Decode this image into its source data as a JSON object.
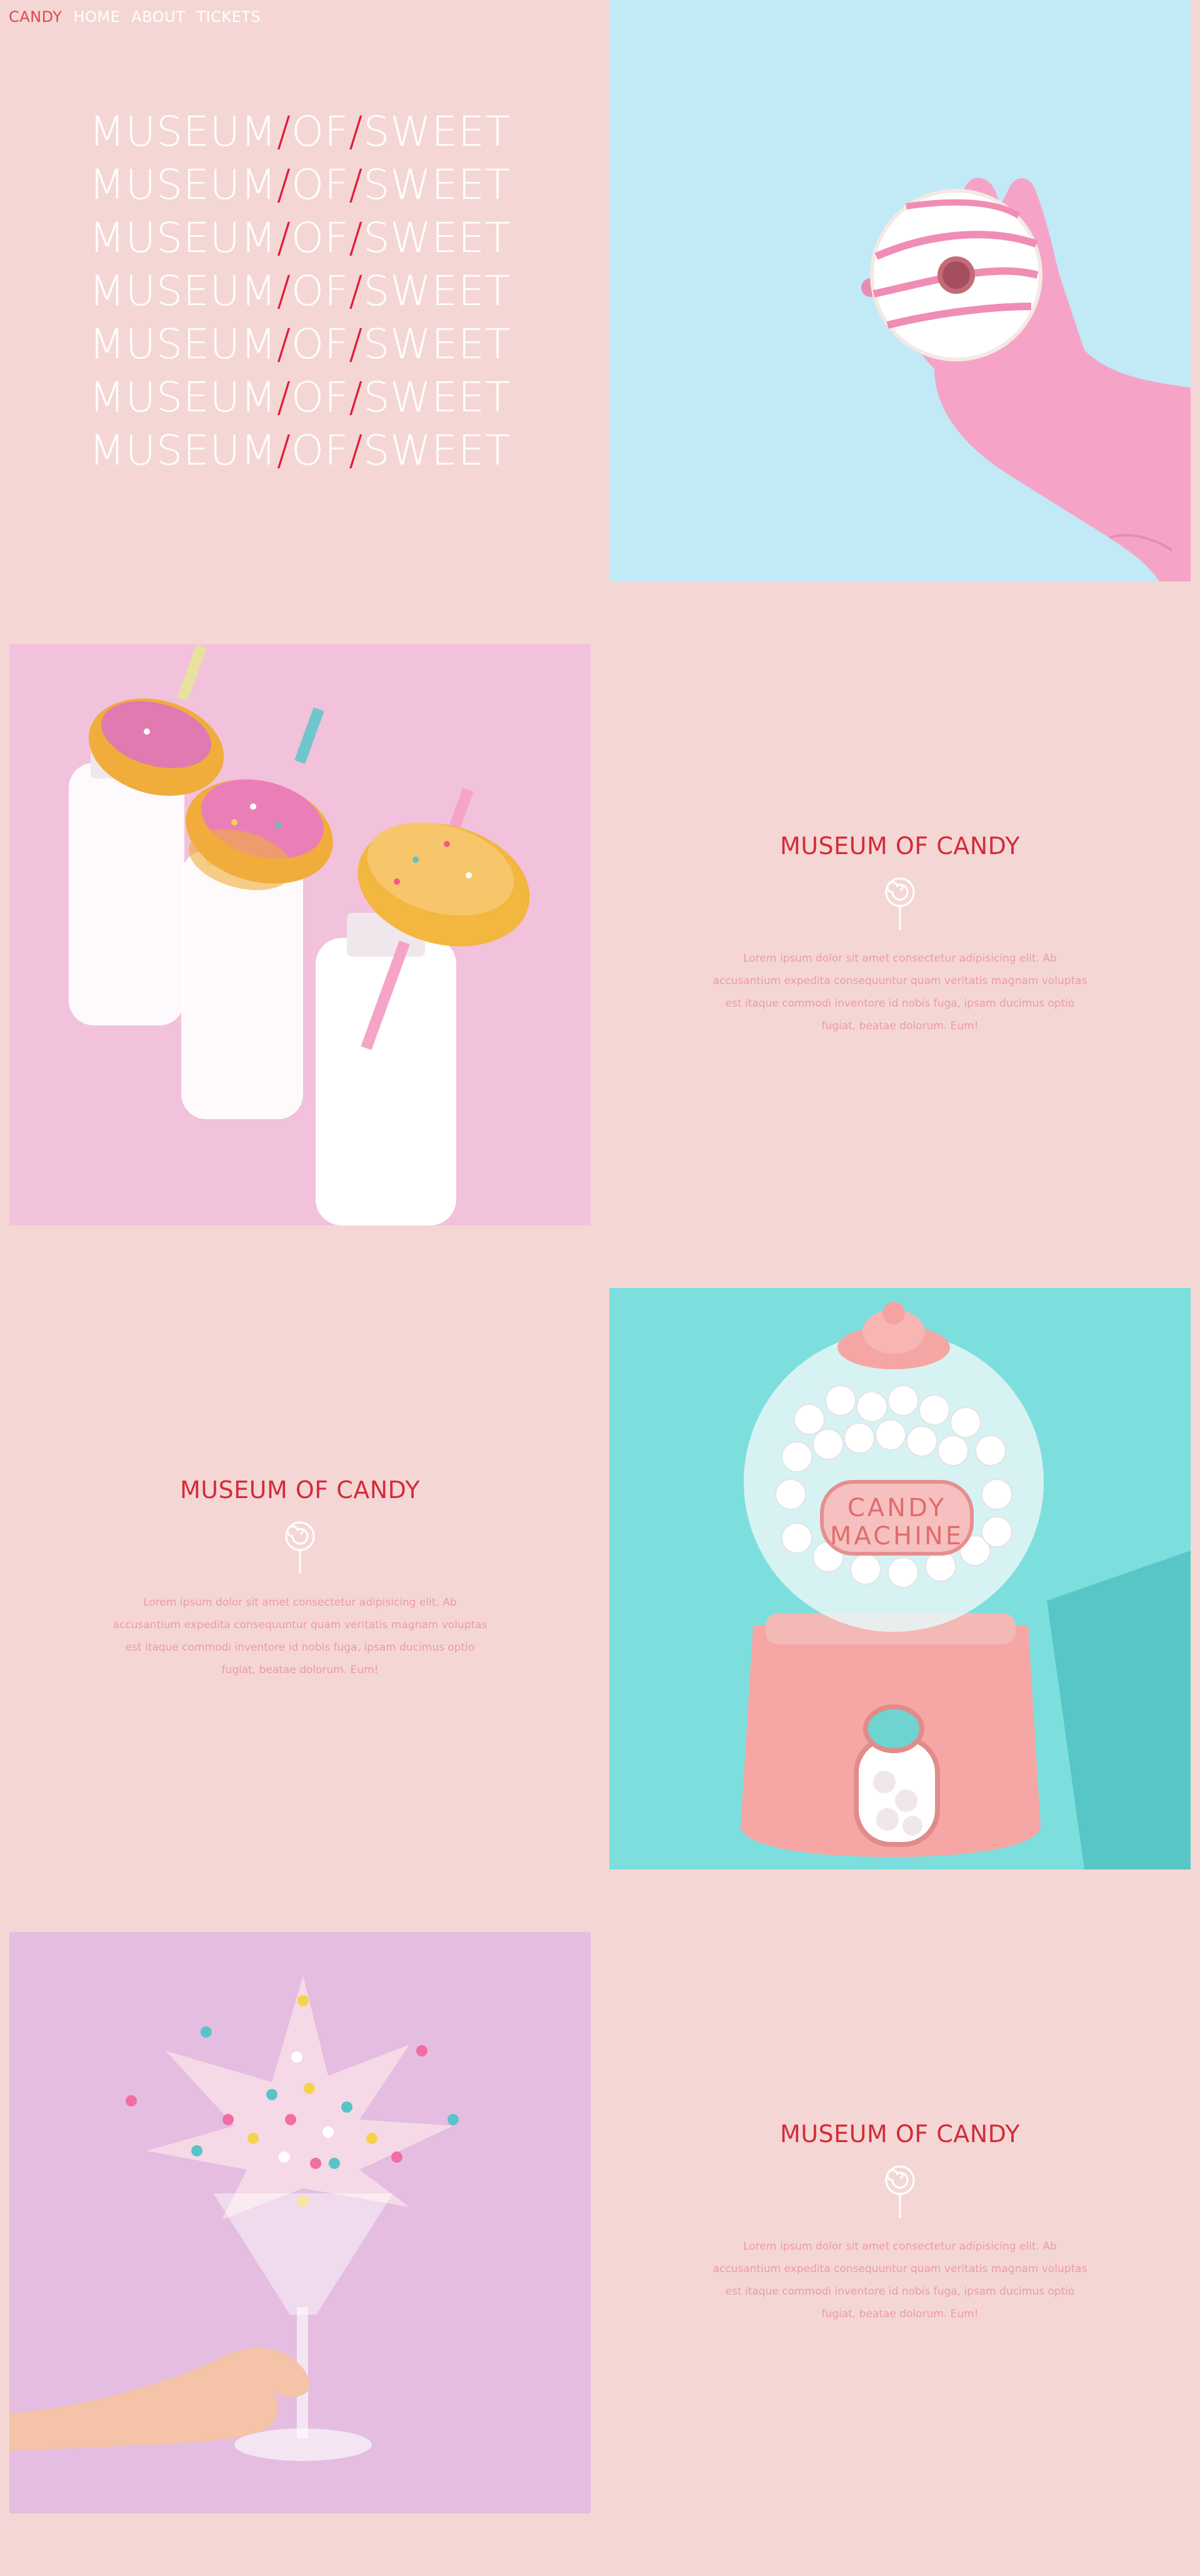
{
  "nav": {
    "logo": "CANDY",
    "links": [
      "HOME",
      "ABOUT",
      "TICKETS"
    ]
  },
  "hero": {
    "line_parts": [
      "MUSEUM",
      "/",
      "OF",
      "/",
      "SWEET"
    ],
    "repeat": 7
  },
  "sections": [
    {
      "title": "MUSEUM OF CANDY",
      "body": "Lorem ipsum dolor sit amet consectetur adipisicing elit. Ab accusantium expedita consequuntur quam veritatis magnam voluptas est itaque commodi inventore id nobis fuga, ipsam ducimus optio fugiat, beatae dolorum. Eum!"
    },
    {
      "title": "MUSEUM OF CANDY",
      "body": "Lorem ipsum dolor sit amet consectetur adipisicing elit. Ab accusantium expedita consequuntur quam veritatis magnam voluptas est itaque commodi inventore id nobis fuga, ipsam ducimus optio fugiat, beatae dolorum. Eum!"
    },
    {
      "title": "MUSEUM OF CANDY",
      "body": "Lorem ipsum dolor sit amet consectetur adipisicing elit. Ab accusantium expedita consequuntur quam veritatis magnam voluptas est itaque commodi inventore id nobis fuga, ipsam ducimus optio fugiat, beatae dolorum. Eum!"
    }
  ],
  "images": {
    "donut_glove": "donut in pink glove",
    "donut_milk": "donuts on milk bottles",
    "gumball_machine": "candy machine",
    "sprinkle_glass": "sprinkles in glass"
  },
  "gumball_label": [
    "CANDY",
    "MACHINE"
  ],
  "colors": {
    "page_bg": "#f4d7d4",
    "accent": "#e31b3a",
    "heading": "#d42b3a",
    "body_text": "#ec9aa8",
    "nav_text": "#ffffff"
  }
}
